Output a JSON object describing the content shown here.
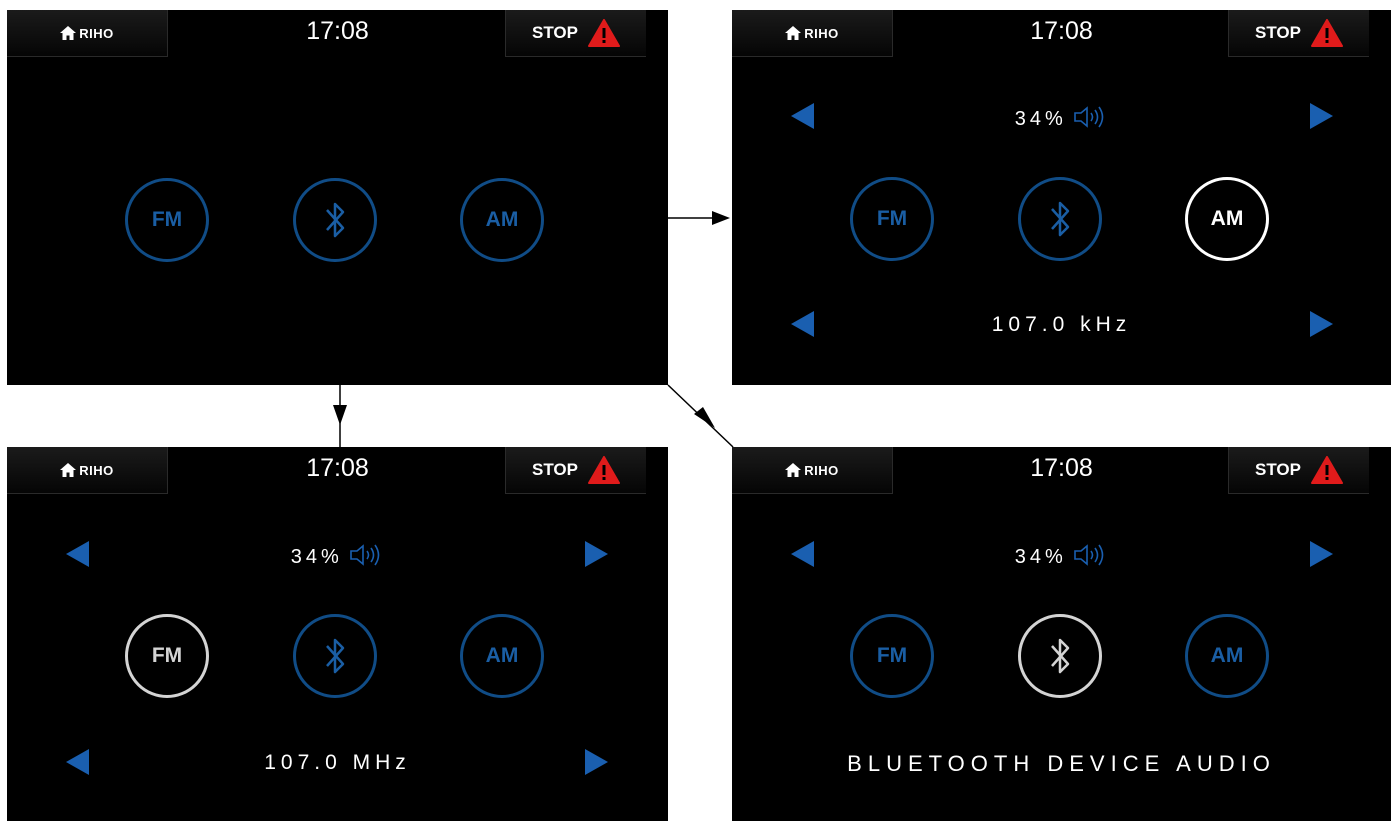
{
  "brand": "RIHO",
  "clock": "17:08",
  "stop_label": "STOP",
  "icons": {
    "home": "home-icon",
    "warning": "warning-triangle-icon",
    "bluetooth": "bluetooth-icon",
    "speaker": "speaker-icon"
  },
  "colors": {
    "accent_blue": "#1a5fb0",
    "ring_blue": "#104c86",
    "active_white": "#ffffff",
    "active_grey": "#d4d4d4",
    "stop_red": "#e01b1b"
  },
  "sources": {
    "fm": "FM",
    "am": "AM"
  },
  "screens": {
    "home": {},
    "am": {
      "volume": "34%",
      "frequency": "107.0 kHz",
      "active": "AM"
    },
    "fm": {
      "volume": "34%",
      "frequency": "107.0 MHz",
      "active": "FM"
    },
    "bluetooth": {
      "volume": "34%",
      "status": "BLUETOOTH DEVICE AUDIO",
      "active": "Bluetooth"
    }
  }
}
